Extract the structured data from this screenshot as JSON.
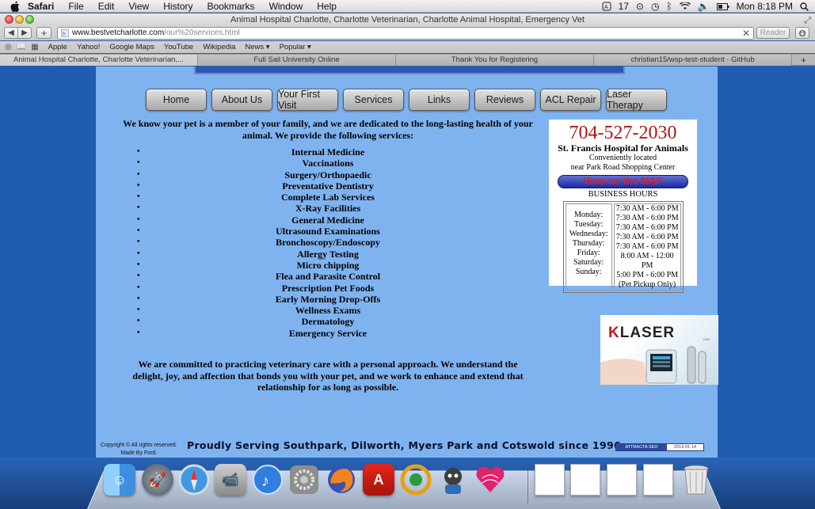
{
  "menubar": {
    "app_name": "Safari",
    "items": [
      "File",
      "Edit",
      "View",
      "History",
      "Bookmarks",
      "Window",
      "Help"
    ],
    "battery_text": "17",
    "clock": "Mon 8:18 PM"
  },
  "window": {
    "title": "Animal Hospital Charlotte, Charlotte Veterinarian, Charlotte Animal Hospital, Emergency Vet"
  },
  "toolbar": {
    "back_label": "◀",
    "forward_label": "▶",
    "add_label": "+",
    "url_host": "www.bestvetcharlotte.com",
    "url_path": "/our%20services.html",
    "reader_label": "Reader"
  },
  "bookmarks": [
    "Apple",
    "Yahoo!",
    "Google Maps",
    "YouTube",
    "Wikipedia",
    "News ▾",
    "Popular ▾"
  ],
  "tabs": [
    "Animal Hospital Charlotte, Charlotte Veterinarian,...",
    "Full Sail University Online",
    "Thank You for Registering",
    "christian15/wsp-test-student · GitHub"
  ],
  "site": {
    "nav": [
      "Home",
      "About Us",
      "Your First Visit",
      "Services",
      "Links",
      "Reviews",
      "ACL Repair",
      "Laser Therapy"
    ],
    "intro": "We know your pet is a member of your family, and we are dedicated to the long-lasting health of your animal. We provide the following services:",
    "bullet": "•",
    "services": [
      "Internal Medicine",
      "Vaccinations",
      "Surgery/Orthopaedic",
      "Preventative Dentistry",
      "Complete Lab Services",
      "X-Ray Facilities",
      "General Medicine",
      "Ultrasound Examinations",
      "Bronchoscopy/Endoscopy",
      "Allergy Testing",
      "Micro chipping",
      "Flea and Parasite Control",
      "Prescription Pet Foods",
      "Early Morning Drop-Offs",
      "Wellness Exams",
      "Dermatology",
      "Emergency Service"
    ],
    "outro": "We are committed to practicing veterinary care with a personal approach. We understand the delight, joy, and affection that bonds you with your pet, and we work to enhance and extend that relationship for as long as possible.",
    "contact": {
      "phone": "704-527-2030",
      "name": "St. Francis Hospital for Animals",
      "line1": "Conveniently located",
      "line2": "near Park Road Shopping Center",
      "map_button": "View on the MAP",
      "hours_title": "BUSINESS HOURS",
      "days": [
        "Monday:",
        "Tuesday:",
        "Wednesday:",
        "Thursday:",
        "Friday:",
        "Saturday:",
        "Sunday:"
      ],
      "times": [
        "7:30 AM - 6:00 PM",
        "7:30 AM - 6:00 PM",
        "7:30 AM - 6:00 PM",
        "7:30 AM - 6:00 PM",
        "7:30 AM - 6:00 PM",
        "8:00 AM - 12:00 PM",
        "5:00 PM - 6:00 PM",
        "(Pet Pickup Only)"
      ]
    },
    "ad": {
      "brand_k": "K",
      "brand_rest": "LASER",
      "brand_suffix": "USA"
    },
    "footer": {
      "copyright_line1": "Copyright © All rights reserved.",
      "copyright_line2": "Made By Ford.",
      "tagline": "Proudly Serving Southpark, Dilworth, Myers Park and Cotswold since 1996",
      "badge_left": "ATTRACTA SEO",
      "badge_right": "2013-01-14"
    }
  },
  "dock": {
    "apps": [
      "finder-icon",
      "launchpad-icon",
      "safari-icon",
      "facetime-icon",
      "itunes-icon",
      "system-preferences-icon",
      "firefox-icon",
      "acrobat-icon",
      "dreamweaver-icon",
      "github-icon",
      "lovebrowser-icon"
    ],
    "colors": {
      "accent_page": "#7fb3f0",
      "accent_background": "#1f5db3",
      "phone_red": "#b01616"
    }
  }
}
